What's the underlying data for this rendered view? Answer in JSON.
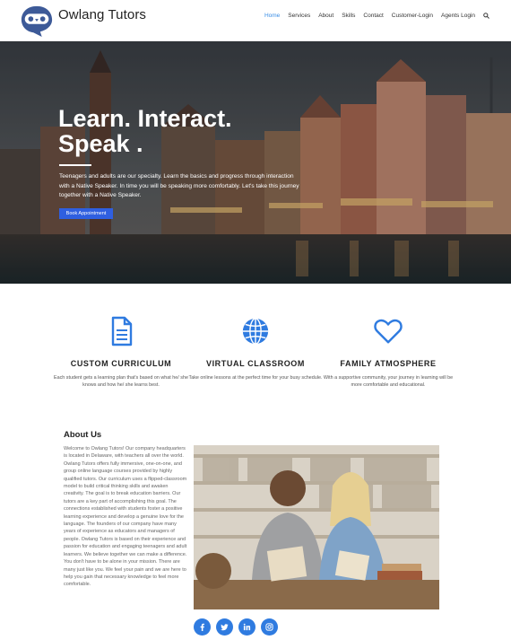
{
  "brand": {
    "name": "Owlang Tutors",
    "logo_icon": "owl-robot-logo-icon"
  },
  "nav": {
    "items": [
      "Home",
      "Services",
      "About",
      "Skills",
      "Contact",
      "Customer-Login",
      "Agents Login"
    ],
    "active": "Home",
    "search_icon": "search-icon"
  },
  "hero": {
    "title_line1": "Learn. Interact.",
    "title_line2": "Speak .",
    "text": "Teenagers and adults are our specialty. Learn the basics and progress through interaction with a Native Speaker. In time you will be speaking more comfortably. Let's take this journey together with a Native Speaker.",
    "button": "Book Appointment"
  },
  "features": [
    {
      "icon": "document-icon",
      "title": "CUSTOM CURRICULUM",
      "text": "Each student gets a learning plan that's based on what he/ she knows and how he/ she learns best."
    },
    {
      "icon": "globe-icon",
      "title": "VIRTUAL CLASSROOM",
      "text": "Take online lessons at the perfect time for your busy schedule."
    },
    {
      "icon": "heart-icon",
      "title": "FAMILY ATMOSPHERE",
      "text": "With a supportive community, your journey in learning will be more comfortable and educational."
    }
  ],
  "about": {
    "title": "About Us",
    "text": "Welcome to Owlang Tutors! Our company headquarters is located in Delaware, with teachers all over the world. Owlang Tutors offers fully immersive, one-on-one, and group online language courses provided by highly qualified tutors. Our curriculum uses a flipped-classroom model to build critical thinking skills and awaken creativity. The goal is to break education barriers. Our tutors are a key part of accomplishing this goal. The connections established with students foster a positive learning experience and develop a genuine love for the language. The founders of our company have many years of experience as educators and managers of people. Owlang Tutors is based on their experience and passion for education and engaging teenagers and adult learners. We believe together we can make a difference. You don't have to be alone in your mission. There are many just like you. We feel your pain and we are here to help you gain that necessary knowledge to feel more comfortable."
  },
  "social": [
    "facebook-icon",
    "twitter-icon",
    "linkedin-icon",
    "instagram-icon"
  ],
  "colors": {
    "accent": "#2f7be0",
    "button": "#2f5fe0",
    "nav_active": "#3a8ee6"
  }
}
